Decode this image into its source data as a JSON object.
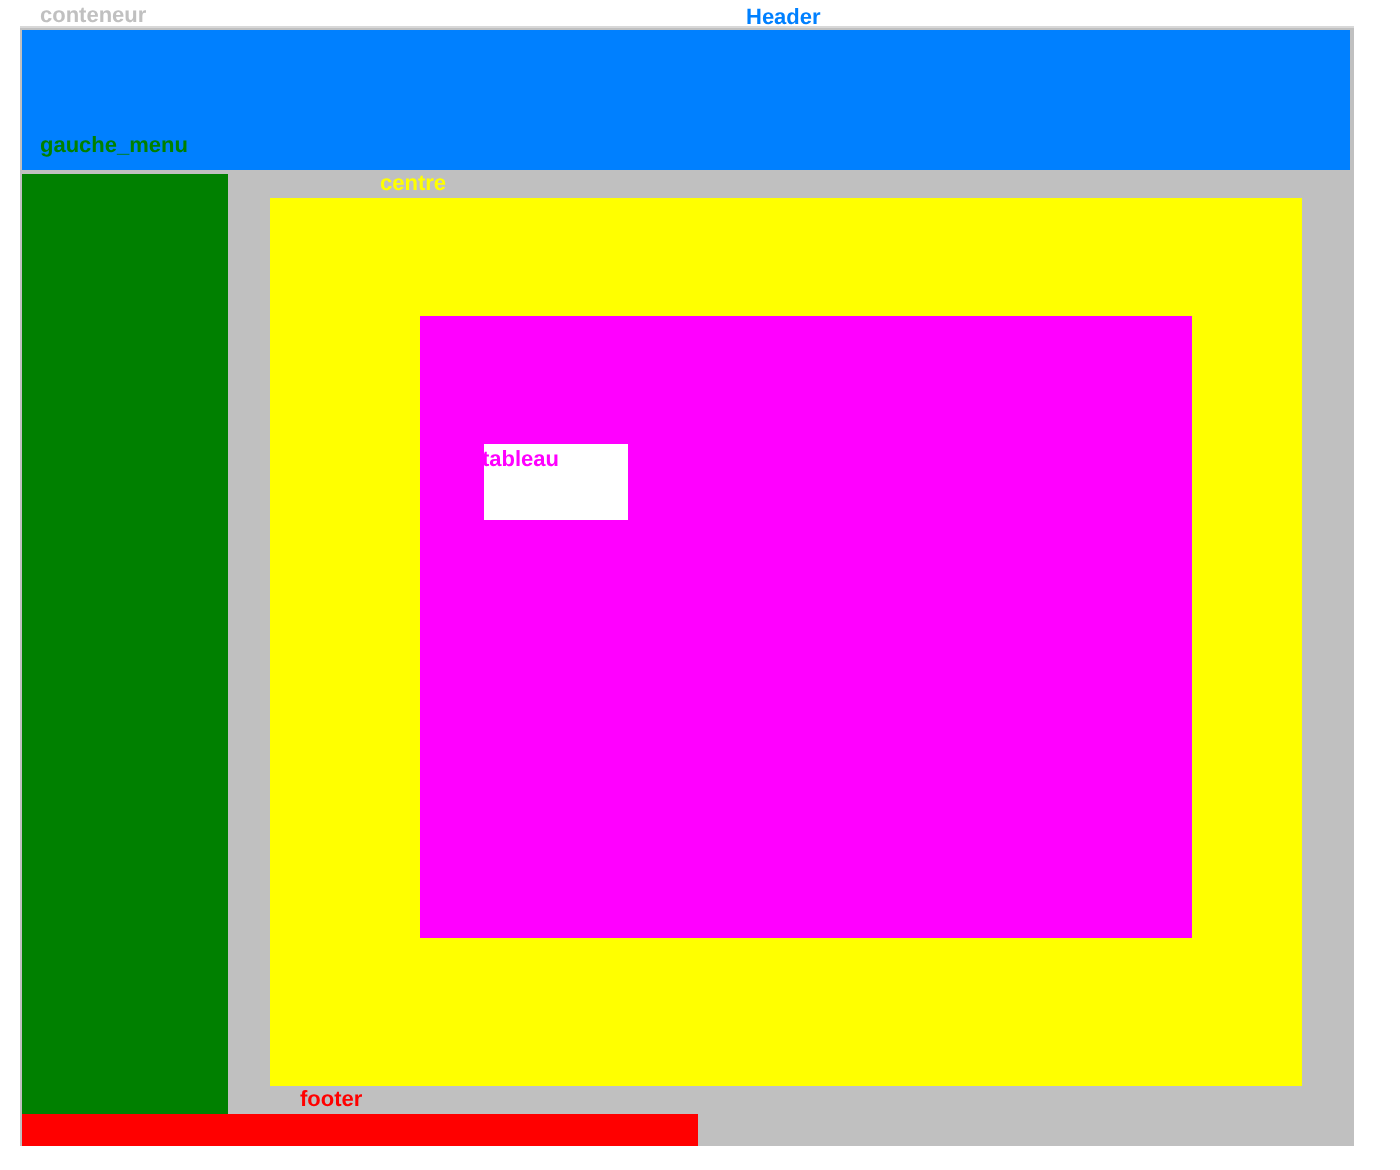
{
  "container": {
    "label": "conteneur",
    "color": "#c0c0c0"
  },
  "header": {
    "label": "Header",
    "color": "#0080ff"
  },
  "left_menu": {
    "label": "gauche_menu",
    "color": "#008000"
  },
  "centre": {
    "label": "centre",
    "color": "#ffff00"
  },
  "inner": {
    "color": "#ff00ff"
  },
  "table": {
    "label": "tableau",
    "color": "#ffffff"
  },
  "footer": {
    "label": "footer",
    "color": "#ff0000"
  }
}
